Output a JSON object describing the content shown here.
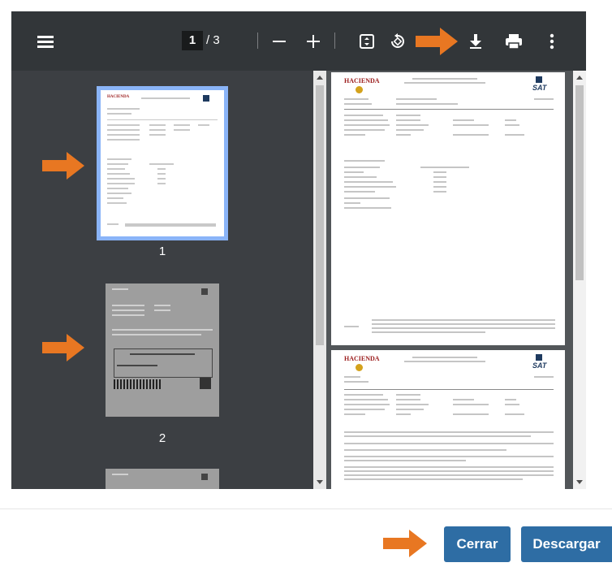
{
  "toolbar": {
    "current_page": "1",
    "page_total": "/ 3"
  },
  "thumbnails": [
    {
      "number": "1",
      "selected": true
    },
    {
      "number": "2",
      "selected": false
    }
  ],
  "pages": [
    {
      "header_left": "HACIENDA",
      "header_right": "SAT"
    },
    {
      "header_left": "HACIENDA",
      "header_right": "SAT"
    }
  ],
  "footer": {
    "close_label": "Cerrar",
    "download_label": "Descargar"
  },
  "colors": {
    "toolbar_bg": "#323639",
    "viewer_bg": "#3c3f43",
    "selected_outline": "#8ab4f8",
    "button_blue": "#2e6da4",
    "arrow_orange": "#e87722"
  },
  "icons": [
    "menu-icon",
    "fit-page-icon",
    "rotate-icon",
    "download-icon",
    "print-icon",
    "more-vert-icon",
    "zoom-out-icon",
    "zoom-in-icon"
  ]
}
